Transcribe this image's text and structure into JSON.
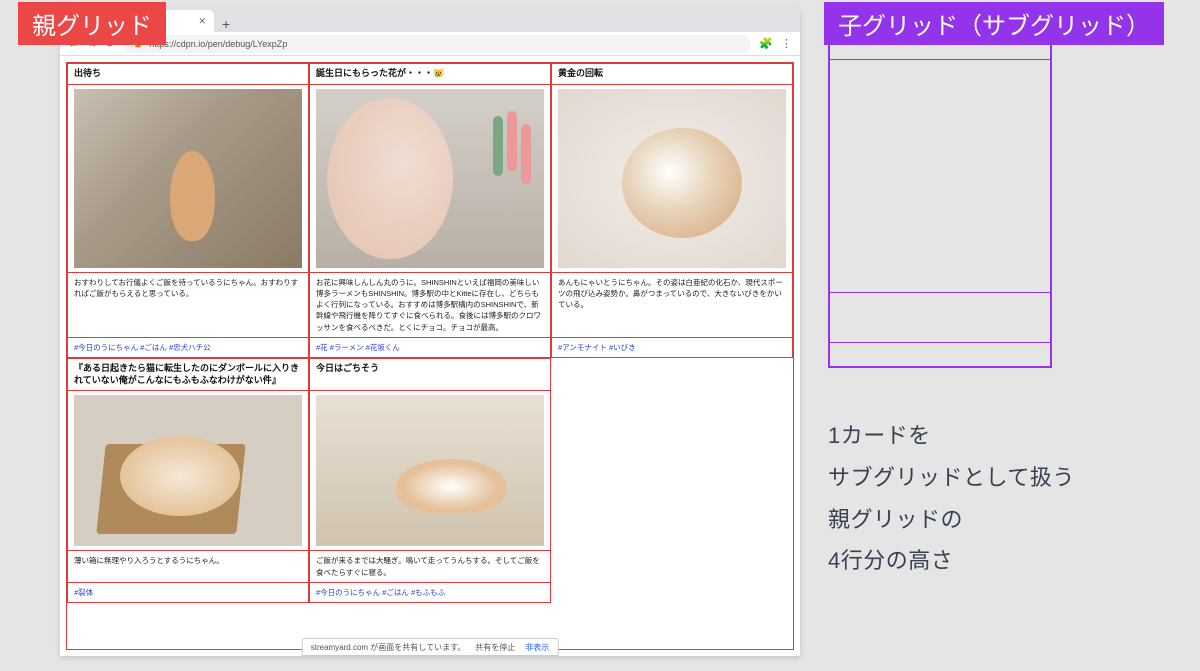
{
  "labels": {
    "parent": "親グリッド",
    "child": "子グリッド（サブグリッド）"
  },
  "browser": {
    "tab_title": "",
    "url": "https://cdpn.io/pen/debug/LYexpZp"
  },
  "cards": [
    {
      "title": "出待ち",
      "desc": "おすわりしてお行儀よくご飯を待っているうにちゃん。おすわりすればご飯がもらえると思っている。",
      "tags": "#今日のうにちゃん #ごはん #忠犬ハチ公"
    },
    {
      "title": "誕生日にもらった花が・・・😿",
      "desc": "お花に興味しんしん丸のうに。SHINSHINといえば福岡の美味しい博多ラーメンもSHINSHIN。博多駅の中とKitteに存在し、どちらもよく行列になっている。おすすめは博多駅構内のSHINSHINで、新幹線や飛行機を降りてすぐに食べられる。食後には博多駅のクロワッサンを食べるべきだ。とくにチョコ。チョコが最高。",
      "tags": "#花 #ラーメン #花坂くん"
    },
    {
      "title": "黄金の回転",
      "desc": "あんもにゃいとうにちゃん。その姿は白亜紀の化石か、現代スポーツの飛び込み姿勢か。鼻がつまっているので、大きないびきをかいている。",
      "tags": "#アンモナイト #いびき"
    },
    {
      "title": "『ある日起きたら猫に転生したのにダンボールに入りきれていない俺がこんなにもふもふなわけがない件』",
      "desc": "薄い箱に無理やり入ろうとするうにちゃん。",
      "tags": "#裂体"
    },
    {
      "title": "今日はごちそう",
      "desc": "ご飯が来るまでは大騒ぎ。鳴いて走ってうんちする。そしてご飯を食べたらすぐに寝る。",
      "tags": "#今日のうにちゃん #ごはん #もふもふ"
    }
  ],
  "side_text": {
    "l1": "1カードを",
    "l2": "サブグリッドとして扱う",
    "l3": "親グリッドの",
    "l4": "4行分の高さ"
  },
  "share": {
    "msg": "streamyard.com が画面を共有しています。",
    "stop": "共有を停止",
    "hide": "非表示"
  }
}
